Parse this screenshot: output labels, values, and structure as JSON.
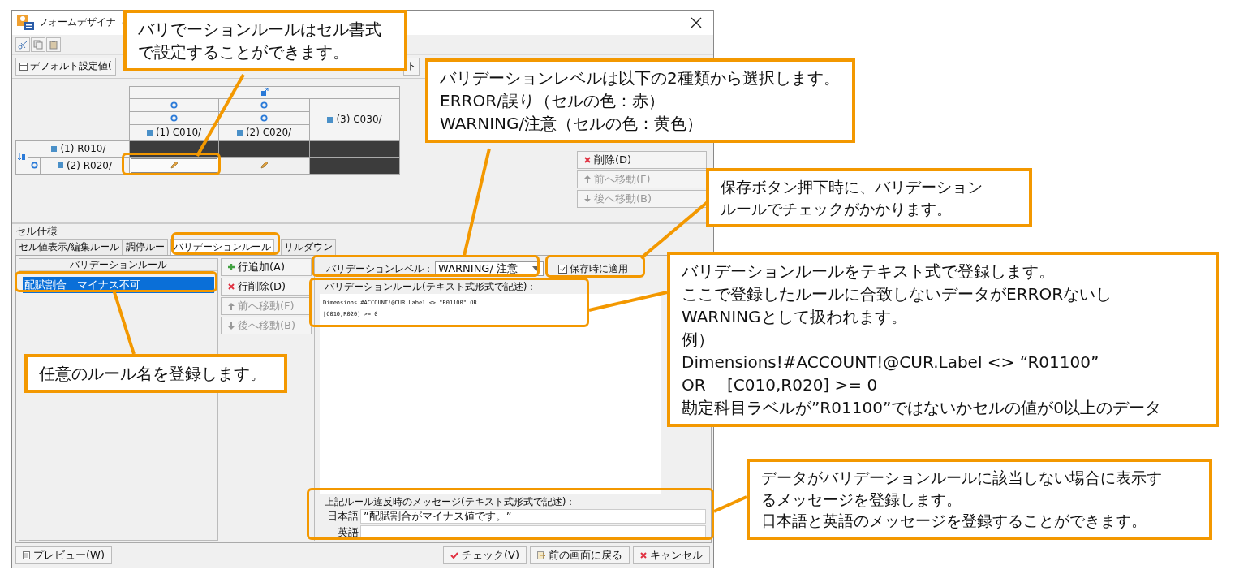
{
  "window": {
    "title": "フォームデザイナ（"
  },
  "top_tabs": [
    {
      "label": "デフォルト設定値("
    },
    {
      "label": "ト"
    }
  ],
  "grid": {
    "columns": [
      {
        "label": "(1) C010/",
        "kind": "grouped"
      },
      {
        "label": "(2) C020/",
        "kind": "grouped"
      },
      {
        "label": "(3) C030/",
        "kind": "plain"
      }
    ],
    "rows": [
      {
        "label": "(1) R010/",
        "kind": "plain",
        "cells": [
          {
            "kind": "locked",
            "selected": false
          },
          {
            "kind": "locked",
            "selected": false
          },
          {
            "kind": "locked",
            "selected": false
          }
        ]
      },
      {
        "label": "(2) R020/",
        "kind": "grouped",
        "cells": [
          {
            "kind": "editable",
            "selected": true
          },
          {
            "kind": "editable",
            "selected": false
          },
          {
            "kind": "locked",
            "selected": false
          }
        ]
      }
    ]
  },
  "grid_buttons": [
    {
      "label": "削除(D)",
      "kind": "delete",
      "disabled": false
    },
    {
      "label": "前へ移動(F)",
      "kind": "up",
      "disabled": true
    },
    {
      "label": "後へ移動(B)",
      "kind": "down",
      "disabled": true
    }
  ],
  "section_title": "セル仕様",
  "tabs": [
    {
      "label": "セル値表示/編集ルール",
      "selected": false
    },
    {
      "label": "調停ルー",
      "selected": false
    },
    {
      "label": "バリデーションルール",
      "selected": true
    },
    {
      "label": "リルダウン",
      "selected": false
    }
  ],
  "rule_list": {
    "header": "バリデーションルール",
    "items": [
      {
        "label": "配賦割合　マイナス不可",
        "selected": true
      }
    ]
  },
  "rule_buttons": [
    {
      "label": "行追加(A)",
      "kind": "add",
      "disabled": false
    },
    {
      "label": "行削除(D)",
      "kind": "delete",
      "disabled": false
    },
    {
      "label": "前へ移動(F)",
      "kind": "up",
      "disabled": true
    },
    {
      "label": "後へ移動(B)",
      "kind": "down",
      "disabled": true
    }
  ],
  "level": {
    "label": "バリデーションレベル：",
    "value": "WARNING/ 注意"
  },
  "apply_on_save": {
    "label": "保存時に適用",
    "checked": true
  },
  "rule_text": {
    "label": "バリデーションルール(テキスト式形式で記述)：",
    "lines": [
      "Dimensions!#ACCOUNT!@CUR.Label <> \"R01100\" OR",
      "[C010,R020] >= 0"
    ]
  },
  "messages": {
    "label": "上記ルール違反時のメッセージ(テキスト式形式で記述)：",
    "fields": [
      {
        "label": "日本語",
        "value": "”配賦割合がマイナス値です。”"
      },
      {
        "label": "英語"
      }
    ]
  },
  "footer_left": [
    {
      "label": "プレビュー(W)",
      "kind": "preview"
    }
  ],
  "footer_right": [
    {
      "label": "チェック(V)",
      "kind": "check"
    },
    {
      "label": "前の画面に戻る",
      "kind": "back"
    },
    {
      "label": "キャンセル",
      "kind": "delete"
    }
  ],
  "callouts": [
    {
      "lines": [
        "バリでーションルールはセル書式",
        "で設定することができます。"
      ]
    },
    {
      "lines": [
        "バリデーションレベルは以下の2種類から選択します。",
        "ERROR/誤り（セルの色：赤）",
        "WARNING/注意（セルの色：黄色）"
      ]
    },
    {
      "lines": [
        "保存ボタン押下時に、バリデーション",
        "ルールでチェックがかかります。"
      ]
    },
    {
      "lines": [
        "バリデーションルールをテキスト式で登録します。",
        "ここで登録したルールに合致しないデータがERRORないし",
        "WARNINGとして扱われます。",
        "例）",
        "Dimensions!#ACCOUNT!@CUR.Label <> “R01100”",
        "OR　 [C010,R020] >= 0",
        "勘定科目ラベルが”R01100”ではないかセルの値が0以上のデータ"
      ]
    },
    {
      "lines": [
        "データがバリデーションルールに該当しない場合に表示す",
        "るメッセージを登録します。",
        "日本語と英語のメッセージを登録することができます。"
      ]
    },
    {
      "lines": [
        "任意のルール名を登録します。"
      ]
    }
  ]
}
